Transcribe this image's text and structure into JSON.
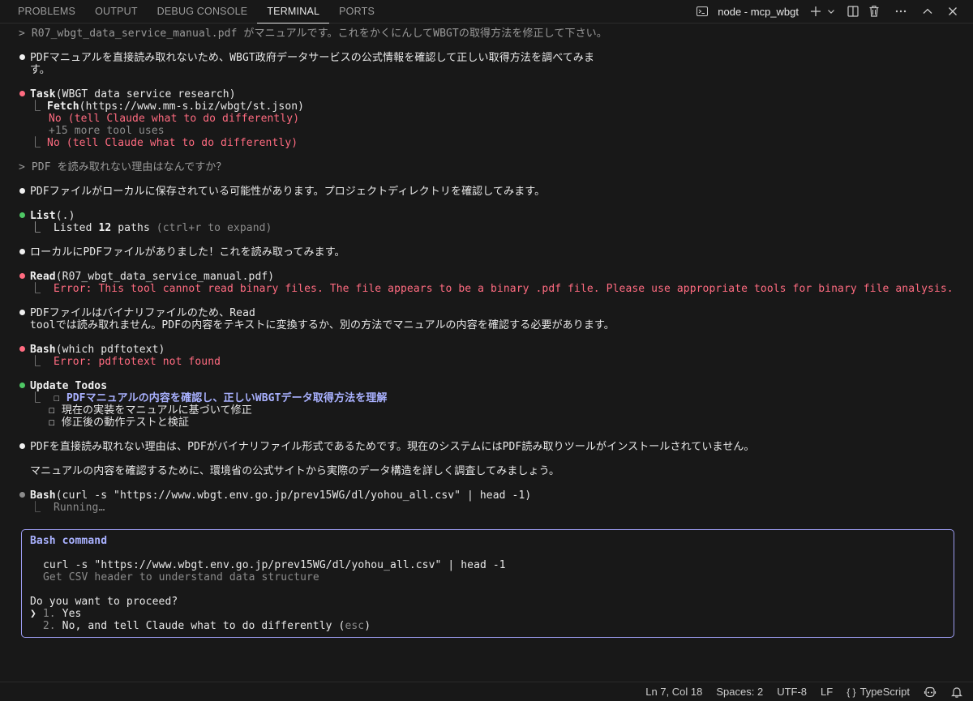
{
  "panel": {
    "tabs": [
      "PROBLEMS",
      "OUTPUT",
      "DEBUG CONSOLE",
      "TERMINAL",
      "PORTS"
    ],
    "active_tab": "TERMINAL",
    "terminal_name": "node - mcp_wbgt",
    "icons": [
      "terminal-icon",
      "plus-icon",
      "chevron-down-icon",
      "split-icon",
      "trash-icon",
      "more-icon",
      "chevron-up-icon",
      "close-icon"
    ]
  },
  "terminal": {
    "l01": "> R07_wbgt_data_service_manual.pdf がマニュアルです。これをかくにんしてWBGTの取得方法を修正して下さい。",
    "l02a": "PDFマニュアルを直接読み取れないため、WBGT政府データサービスの公式情報を確認して正しい取得方法を調べてみま",
    "l02b": "す。",
    "l03_tool": "Task",
    "l03_arg": "(WBGT data service research)",
    "l04_pre": "⎿ ",
    "l04_tool": "Fetch",
    "l04_arg": "(https://www.mm-s.biz/wbgt/st.json)",
    "l05": "No (tell Claude what to do differently)",
    "l06": "+15 more tool uses",
    "l07_pre": "⎿ ",
    "l07": "No (tell Claude what to do differently)",
    "l08": "> PDF を読み取れない理由はなんですか？",
    "l09": "PDFファイルがローカルに保存されている可能性があります。プロジェクトディレクトリを確認してみます。",
    "l10_tool": "List",
    "l10_arg": "(.)",
    "l11_pre": "⎿  Listed ",
    "l11_num": "12",
    "l11_post": " paths",
    "l11_hint": " (ctrl+r to expand)",
    "l12": "ローカルにPDFファイルがありました！これを読み取ってみます。",
    "l13_tool": "Read",
    "l13_arg": "(R07_wbgt_data_service_manual.pdf)",
    "l14_pre": "⎿  ",
    "l14": "Error: This tool cannot read binary files. The file appears to be a binary .pdf file. Please use appropriate tools for binary file analysis.",
    "l15a": "PDFファイルはバイナリファイルのため、Read",
    "l15b": "toolでは読み取れません。PDFの内容をテキストに変換するか、別の方法でマニュアルの内容を確認する必要があります。",
    "l16_tool": "Bash",
    "l16_arg": "(which pdftotext)",
    "l17_pre": "⎿  ",
    "l17": "Error: pdftotext not found",
    "l18": "Update Todos",
    "l19_pre": "⎿  ☐ ",
    "l19": "PDFマニュアルの内容を確認し、正しいWBGTデータ取得方法を理解",
    "l20": "☐ 現在の実装をマニュアルに基づいて修正",
    "l21": "☐ 修正後の動作テストと検証",
    "l22": "PDFを直接読み取れない理由は、PDFがバイナリファイル形式であるためです。現在のシステムにはPDF読み取りツールがインストールされていません。",
    "l23": "マニュアルの内容を確認するために、環境省の公式サイトから実際のデータ構造を詳しく調査してみましょう。",
    "l24_tool": "Bash",
    "l24_arg": "(curl -s \"https://www.wbgt.env.go.jp/prev15WG/dl/yohou_all.csv\" | head -1)",
    "l25": "⎿  Running…"
  },
  "bash_prompt": {
    "title": "Bash command",
    "command": "curl -s \"https://www.wbgt.env.go.jp/prev15WG/dl/yohou_all.csv\" | head -1",
    "description": "Get CSV header to understand data structure",
    "question": "Do you want to proceed?",
    "opt1_cursor": "❯",
    "opt1_num": "1.",
    "opt1": "Yes",
    "opt2_num": "2.",
    "opt2": "No, and tell Claude what to do differently",
    "opt2_hint": "esc"
  },
  "statusbar": {
    "position": "Ln 7, Col 18",
    "spaces": "Spaces: 2",
    "encoding": "UTF-8",
    "eol": "LF",
    "language_glyph": "{ }",
    "language": "TypeScript"
  },
  "colors": {
    "background": "#181818",
    "bullet_white": "#f0f0f0",
    "bullet_red": "#ff6b80",
    "bullet_green": "#4ec764",
    "bullet_gray": "#8b8b8b",
    "error_red": "#ff6b80",
    "accent_blue": "#a9b1ff"
  }
}
